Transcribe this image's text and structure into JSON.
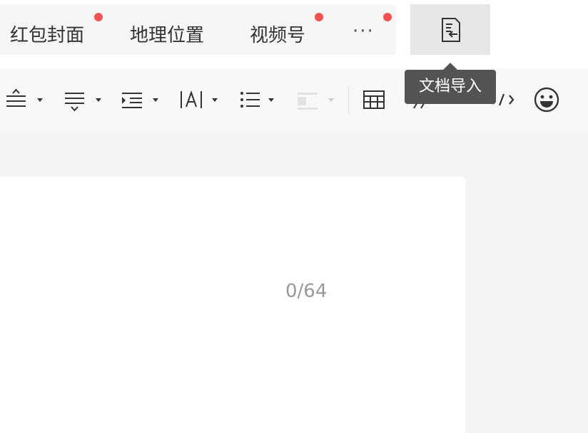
{
  "menu": {
    "items": [
      {
        "label": "红包封面",
        "badge": true
      },
      {
        "label": "地理位置",
        "badge": false
      },
      {
        "label": "视频号",
        "badge": true
      }
    ],
    "more_label": "···",
    "more_badge": true,
    "import_icon": "document-import-icon"
  },
  "tooltip": {
    "text": "文档导入"
  },
  "toolbar": {
    "tools": [
      {
        "name": "align-icon",
        "has_dropdown": true
      },
      {
        "name": "paragraph-spacing-icon",
        "has_dropdown": true
      },
      {
        "name": "indent-icon",
        "has_dropdown": true
      },
      {
        "name": "letter-spacing-icon",
        "has_dropdown": true
      },
      {
        "name": "list-icon",
        "has_dropdown": true
      },
      {
        "name": "block-style-icon",
        "has_dropdown": true,
        "disabled": true
      },
      {
        "name": "table-icon",
        "has_dropdown": false
      },
      {
        "name": "quote-icon",
        "has_dropdown": false
      },
      {
        "name": "code-icon",
        "has_dropdown": false
      },
      {
        "name": "emoji-icon",
        "has_dropdown": false
      }
    ]
  },
  "editor": {
    "counter": "0/64"
  },
  "colors": {
    "badge": "#f25350",
    "tooltip_bg": "#535353",
    "counter": "#999999"
  }
}
